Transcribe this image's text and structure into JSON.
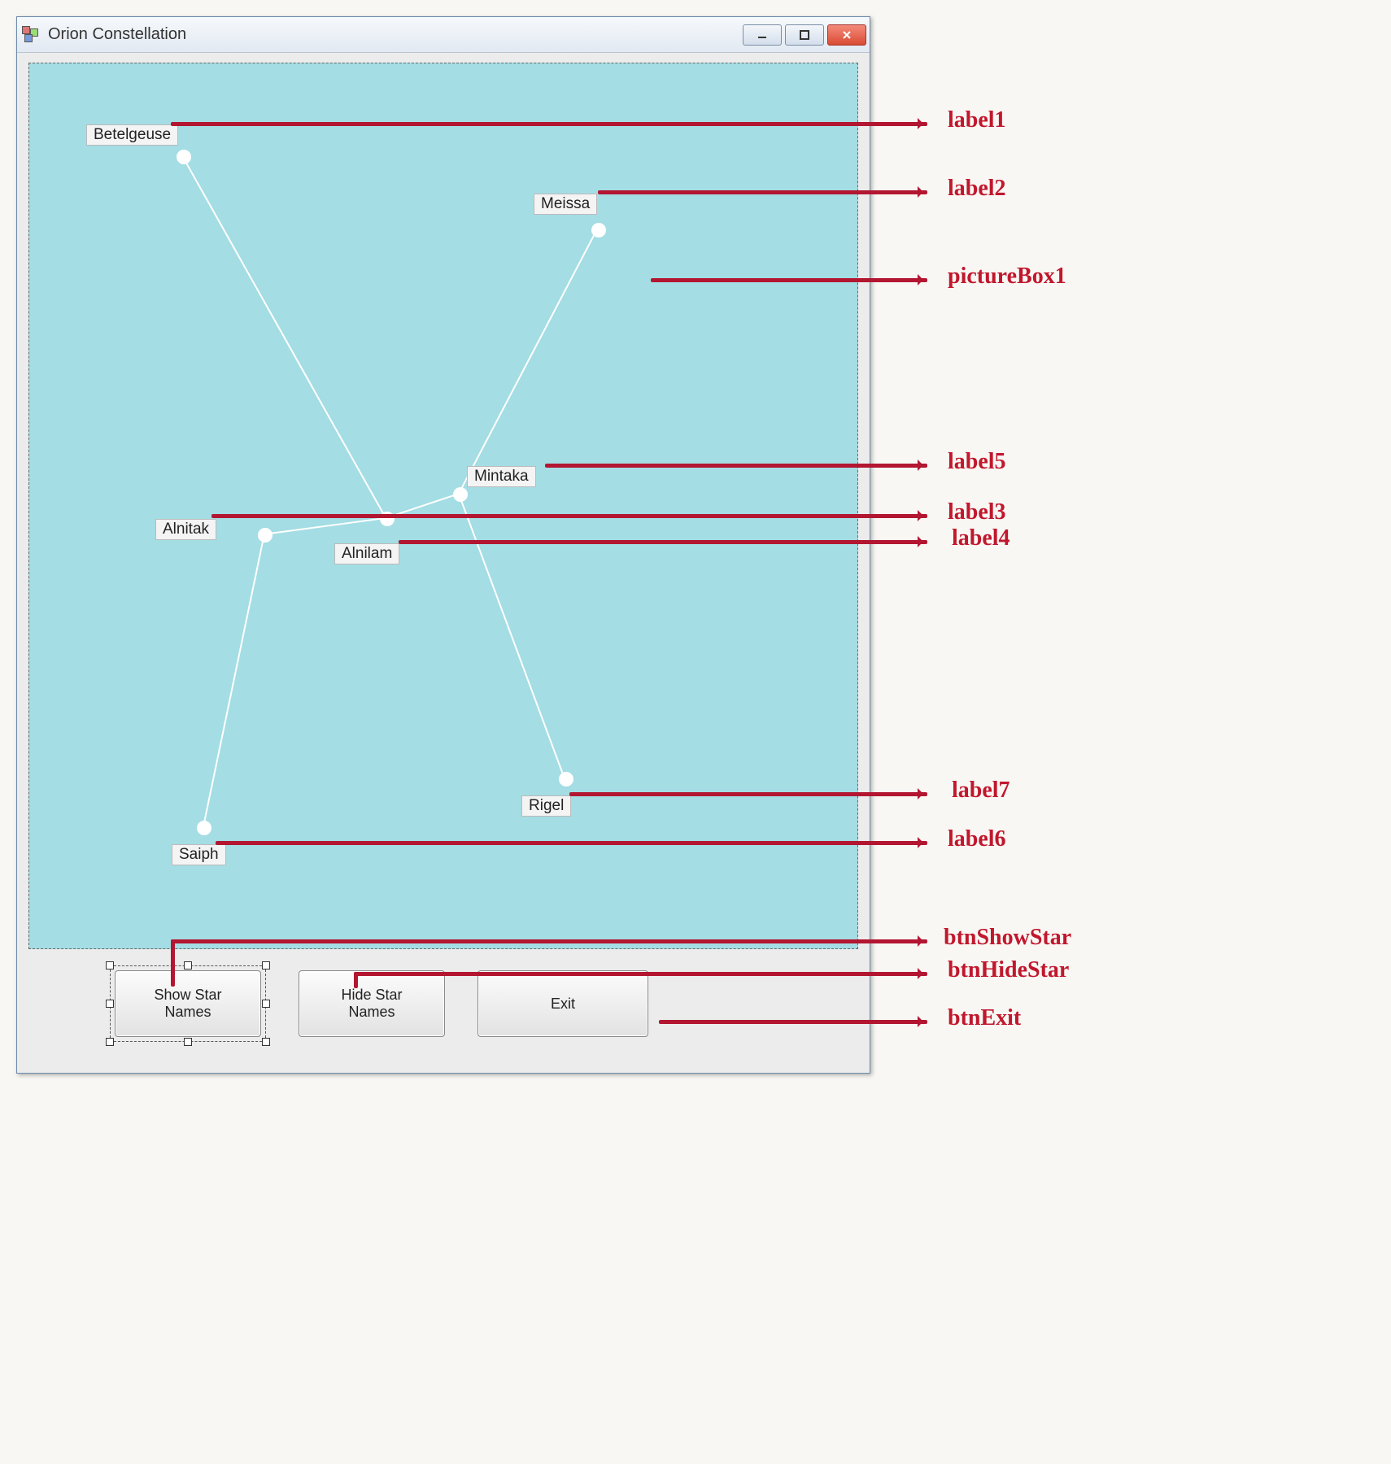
{
  "window": {
    "title": "Orion Constellation"
  },
  "stars": {
    "betelgeuse": "Betelgeuse",
    "meissa": "Meissa",
    "alnitak": "Alnitak",
    "alnilam": "Alnilam",
    "mintaka": "Mintaka",
    "saiph": "Saiph",
    "rigel": "Rigel"
  },
  "buttons": {
    "show": "Show Star\nNames",
    "hide": "Hide Star\nNames",
    "exit": "Exit"
  },
  "annotations": {
    "label1": "label1",
    "label2": "label2",
    "label3": "label3",
    "label4": "label4",
    "label5": "label5",
    "label6": "label6",
    "label7": "label7",
    "pictureBox1": "pictureBox1",
    "btnShowStar": "btnShowStar",
    "btnHideStar": "btnHideStar",
    "btnExit": "btnExit"
  }
}
